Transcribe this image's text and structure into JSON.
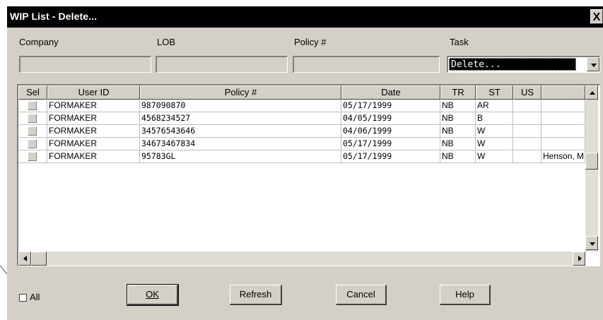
{
  "window": {
    "title": "WIP List - Delete...",
    "close_glyph": "X"
  },
  "filters": {
    "company_label": "Company",
    "lob_label": "LOB",
    "policy_label": "Policy #",
    "task_label": "Task",
    "company_value": "",
    "lob_value": "",
    "policy_value": "",
    "task_value": "Delete..."
  },
  "grid": {
    "headers": {
      "sel": "Sel",
      "user_id": "User ID",
      "policy": "Policy #",
      "date": "Date",
      "tr": "TR",
      "st": "ST",
      "us": "US",
      "extra": ""
    },
    "rows": [
      {
        "user_id": "FORMAKER",
        "policy": "987090870",
        "date": "05/17/1999",
        "tr": "NB",
        "st": "AR",
        "us": "",
        "extra": ""
      },
      {
        "user_id": "FORMAKER",
        "policy": "4568234527",
        "date": "04/05/1999",
        "tr": "NB",
        "st": "B",
        "us": "",
        "extra": ""
      },
      {
        "user_id": "FORMAKER",
        "policy": "34576543646",
        "date": "04/06/1999",
        "tr": "NB",
        "st": "W",
        "us": "",
        "extra": ""
      },
      {
        "user_id": "FORMAKER",
        "policy": "34673467834",
        "date": "05/17/1999",
        "tr": "NB",
        "st": "W",
        "us": "",
        "extra": ""
      },
      {
        "user_id": "FORMAKER",
        "policy": "95783GL",
        "date": "05/17/1999",
        "tr": "NB",
        "st": "W",
        "us": "",
        "extra": "Henson, M"
      }
    ]
  },
  "footer": {
    "all_label": "All",
    "ok_label": "OK",
    "refresh_label": "Refresh",
    "cancel_label": "Cancel",
    "help_label": "Help"
  },
  "icons": {
    "close": "close-icon",
    "dropdown": "chevron-down-icon",
    "scroll_up": "arrow-up-icon",
    "scroll_down": "arrow-down-icon",
    "scroll_left": "arrow-left-icon",
    "scroll_right": "arrow-right-icon"
  },
  "colors": {
    "titlebar": "#000000",
    "dialog": "#d4d0c8",
    "selection": "#000000"
  }
}
